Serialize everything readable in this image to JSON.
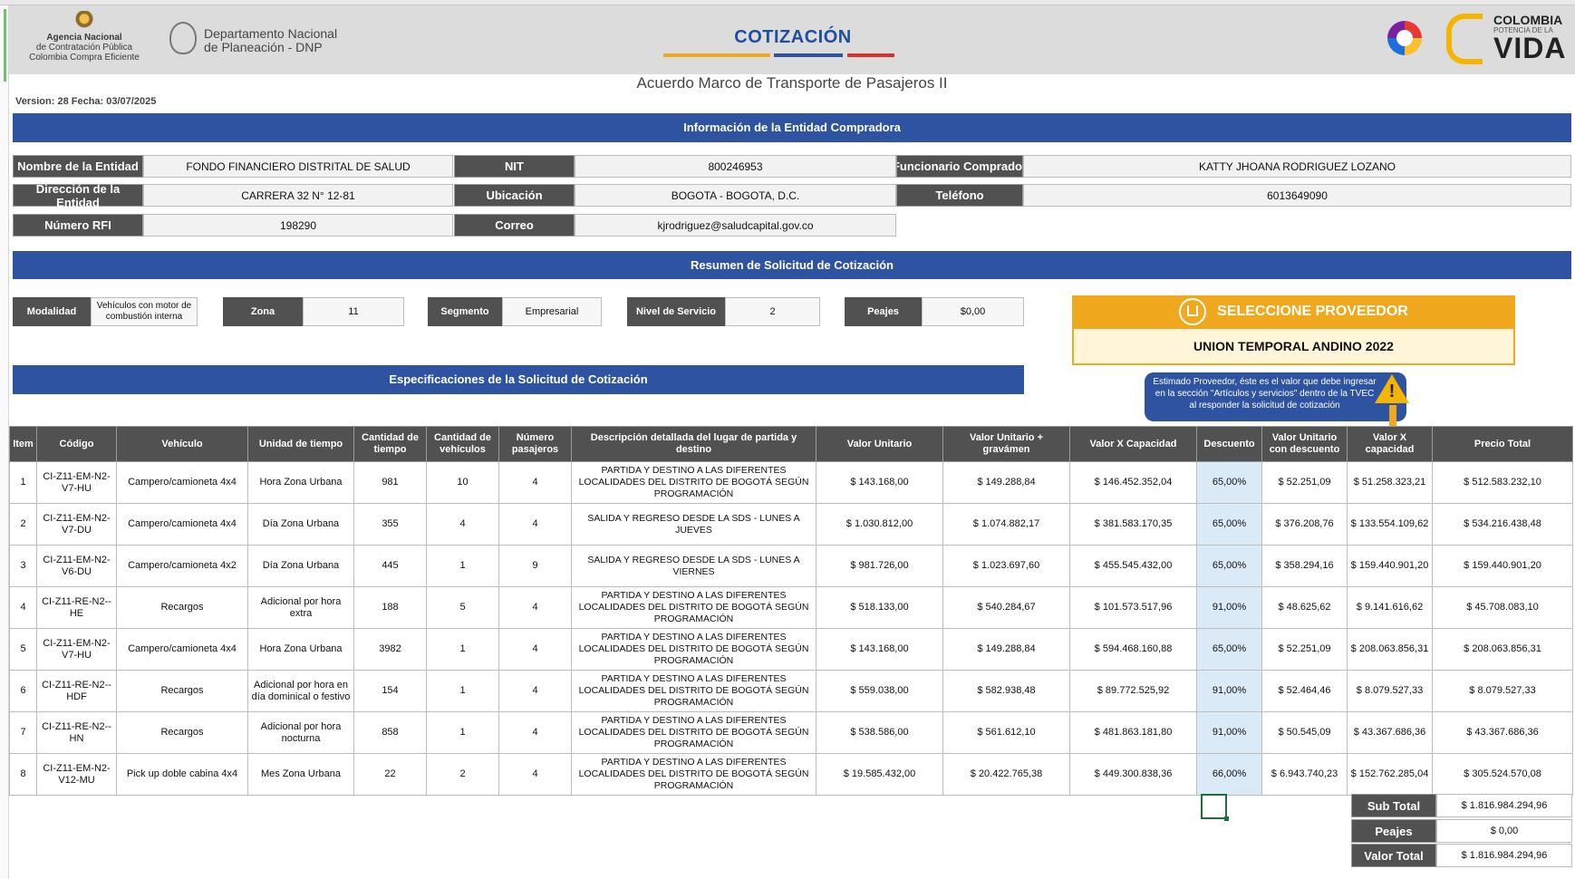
{
  "header": {
    "agency_line1": "Agencia Nacional",
    "agency_line2": "de Contratación Pública",
    "agency_line3": "Colombia Compra Eficiente",
    "dnp_line1": "Departamento Nacional",
    "dnp_line2": "de Planeación - DNP",
    "doc_title": "COTIZACIÓN",
    "vida_line1": "COLOMBIA",
    "vida_line2": "POTENCIA DE LA",
    "vida_line3": "VIDA",
    "subtitle": "Acuerdo Marco de Transporte de Pasajeros II",
    "version": "Version: 28  Fecha: 03/07/2025",
    "title_underline_colors": [
      "#f0a81e",
      "#2e53a0",
      "#d9322b"
    ]
  },
  "entidad": {
    "band_title": "Información de la Entidad Compradora",
    "nombre_label": "Nombre de la Entidad",
    "nombre_value": "FONDO FINANCIERO DISTRITAL DE SALUD",
    "nit_label": "NIT",
    "nit_value": "800246953",
    "funcionario_label": "Funcionario Comprador",
    "funcionario_value": "KATTY JHOANA RODRIGUEZ LOZANO",
    "direccion_label": "Dirección de la Entidad",
    "direccion_value": "CARRERA 32 N° 12-81",
    "ubicacion_label": "Ubicación",
    "ubicacion_value": "BOGOTA - BOGOTA, D.C.",
    "telefono_label": "Teléfono",
    "telefono_value": "6013649090",
    "rfi_label": "Número RFI",
    "rfi_value": "198290",
    "correo_label": "Correo",
    "correo_value": "kjrodriguez@saludcapital.gov.co"
  },
  "resumen": {
    "band_title": "Resumen de Solicitud de Cotización",
    "modalidad_label": "Modalidad",
    "modalidad_value": "Vehículos con motor de combustión interna",
    "zona_label": "Zona",
    "zona_value": "11",
    "segmento_label": "Segmento",
    "segmento_value": "Empresarial",
    "nivel_label": "Nivel de Servicio",
    "nivel_value": "2",
    "peajes_label": "Peajes",
    "peajes_value": "$0,00"
  },
  "proveedor": {
    "header": "SELECCIONE PROVEEDOR",
    "name": "UNION TEMPORAL ANDINO 2022",
    "tip": "Estimado Proveedor, éste es el valor que debe ingresar en la sección \"Artículos y servicios\" dentro de la TVEC al responder la solicitud de cotización",
    "warn_glyph": "!",
    "accent": "#f0a81e"
  },
  "specs": {
    "band_title": "Especificaciones de la Solicitud de Cotización"
  },
  "table": {
    "columns": [
      "Item",
      "Código",
      "Vehículo",
      "Unidad de tiempo",
      "Cantidad de tiempo",
      "Cantidad de vehículos",
      "Número pasajeros",
      "Descripción detallada del lugar de partida y destino",
      "Valor Unitario",
      "Valor Unitario + gravámen",
      "Valor X Capacidad",
      "Descuento",
      "Valor Unitario con descuento",
      "Valor X capacidad",
      "Precio Total"
    ],
    "rows": [
      [
        "1",
        "CI-Z11-EM-N2-V7-HU",
        "Campero/camioneta 4x4",
        "Hora Zona Urbana",
        "981",
        "10",
        "4",
        "PARTIDA Y DESTINO A LAS DIFERENTES LOCALIDADES DEL DISTRITO DE BOGOTÁ SEGÚN PROGRAMACIÓN",
        "$ 143.168,00",
        "$ 149.288,84",
        "$ 146.452.352,04",
        "65,00%",
        "$ 52.251,09",
        "$ 51.258.323,21",
        "$ 512.583.232,10"
      ],
      [
        "2",
        "CI-Z11-EM-N2-V7-DU",
        "Campero/camioneta 4x4",
        "Día Zona Urbana",
        "355",
        "4",
        "4",
        "SALIDA Y REGRESO DESDE LA SDS - LUNES A JUEVES",
        "$ 1.030.812,00",
        "$ 1.074.882,17",
        "$ 381.583.170,35",
        "65,00%",
        "$ 376.208,76",
        "$ 133.554.109,62",
        "$ 534.216.438,48"
      ],
      [
        "3",
        "CI-Z11-EM-N2-V6-DU",
        "Campero/camioneta 4x2",
        "Día Zona Urbana",
        "445",
        "1",
        "9",
        "SALIDA Y REGRESO DESDE LA SDS - LUNES A VIERNES",
        "$ 981.726,00",
        "$ 1.023.697,60",
        "$ 455.545.432,00",
        "65,00%",
        "$ 358.294,16",
        "$ 159.440.901,20",
        "$ 159.440.901,20"
      ],
      [
        "4",
        "CI-Z11-RE-N2--HE",
        "Recargos",
        "Adicional por hora extra",
        "188",
        "5",
        "4",
        "PARTIDA Y DESTINO A LAS DIFERENTES LOCALIDADES DEL DISTRITO DE BOGOTÁ SEGÚN PROGRAMACIÓN",
        "$ 518.133,00",
        "$ 540.284,67",
        "$ 101.573.517,96",
        "91,00%",
        "$ 48.625,62",
        "$ 9.141.616,62",
        "$ 45.708.083,10"
      ],
      [
        "5",
        "CI-Z11-EM-N2-V7-HU",
        "Campero/camioneta 4x4",
        "Hora Zona Urbana",
        "3982",
        "1",
        "4",
        "PARTIDA Y DESTINO A LAS DIFERENTES LOCALIDADES DEL DISTRITO DE BOGOTÁ SEGÚN PROGRAMACIÓN",
        "$ 143.168,00",
        "$ 149.288,84",
        "$ 594.468.160,88",
        "65,00%",
        "$ 52.251,09",
        "$ 208.063.856,31",
        "$ 208.063.856,31"
      ],
      [
        "6",
        "CI-Z11-RE-N2--HDF",
        "Recargos",
        "Adicional por hora en día dominical o festivo",
        "154",
        "1",
        "4",
        "PARTIDA Y DESTINO A LAS DIFERENTES LOCALIDADES DEL DISTRITO DE BOGOTÁ SEGÚN PROGRAMACIÓN",
        "$ 559.038,00",
        "$ 582.938,48",
        "$ 89.772.525,92",
        "91,00%",
        "$ 52.464,46",
        "$ 8.079.527,33",
        "$ 8.079.527,33"
      ],
      [
        "7",
        "CI-Z11-RE-N2--HN",
        "Recargos",
        "Adicional por hora nocturna",
        "858",
        "1",
        "4",
        "PARTIDA Y DESTINO A LAS DIFERENTES LOCALIDADES DEL DISTRITO DE BOGOTÁ SEGÚN PROGRAMACIÓN",
        "$ 538.586,00",
        "$ 561.612,10",
        "$ 481.863.181,80",
        "91,00%",
        "$ 50.545,09",
        "$ 43.367.686,36",
        "$ 43.367.686,36"
      ],
      [
        "8",
        "CI-Z11-EM-N2-V12-MU",
        "Pick up doble cabina 4x4",
        "Mes Zona Urbana",
        "22",
        "2",
        "4",
        "PARTIDA Y DESTINO A LAS DIFERENTES LOCALIDADES DEL DISTRITO DE BOGOTÁ SEGÚN PROGRAMACIÓN",
        "$ 19.585.432,00",
        "$ 20.422.765,38",
        "$ 449.300.838,36",
        "66,00%",
        "$ 6.943.740,23",
        "$ 152.762.285,04",
        "$ 305.524.570,08"
      ]
    ]
  },
  "totals": {
    "subtotal_label": "Sub Total",
    "subtotal_value": "$ 1.816.984.294,96",
    "peajes_label": "Peajes",
    "peajes_value": "$ 0,00",
    "total_label": "Valor Total",
    "total_value": "$ 1.816.984.294,96"
  }
}
